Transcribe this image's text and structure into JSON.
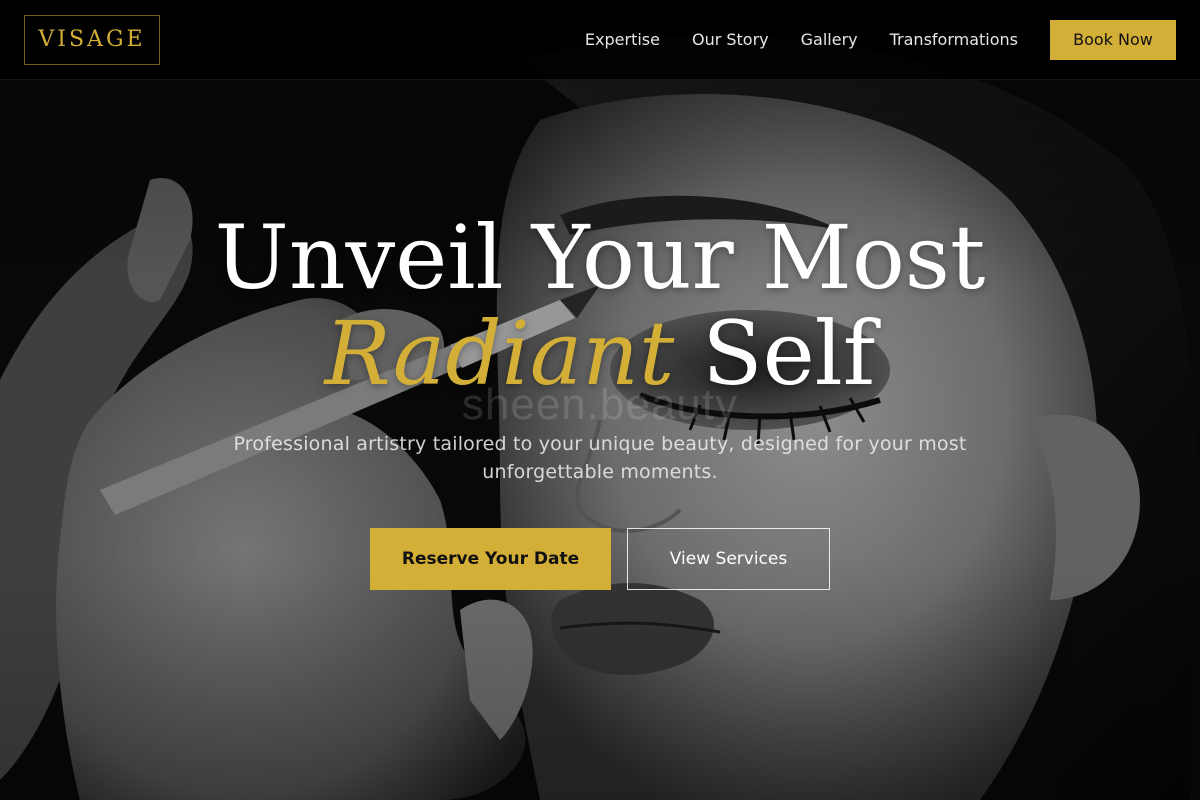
{
  "brand": {
    "logo_text": "VISAGE",
    "accent_color": "#d4af37"
  },
  "nav": {
    "items": [
      {
        "label": "Expertise"
      },
      {
        "label": "Our Story"
      },
      {
        "label": "Gallery"
      },
      {
        "label": "Transformations"
      }
    ],
    "book_label": "Book Now"
  },
  "hero": {
    "headline_line1": "Unveil Your Most",
    "headline_accent": "Radiant",
    "headline_line2_rest": " Self",
    "subtitle": "Professional artistry tailored to your unique beauty, designed for your most unforgettable moments.",
    "primary_cta": "Reserve Your Date",
    "secondary_cta": "View Services",
    "watermark": "sheen.beauty",
    "image": "black-and-white portrait of woman receiving eye makeup"
  }
}
